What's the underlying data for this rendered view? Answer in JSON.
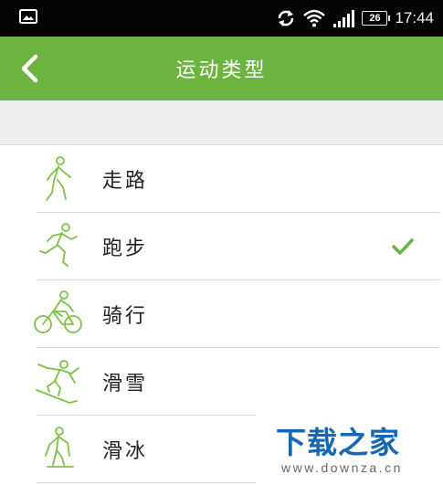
{
  "status_bar": {
    "time": "17:44",
    "battery_level": "26",
    "icons": [
      "gallery-icon",
      "sync-icon",
      "wifi-icon",
      "signal-icon",
      "battery-icon"
    ]
  },
  "app_bar": {
    "title": "运动类型",
    "back_icon": "back-arrow-icon",
    "background": "#6cb33f"
  },
  "sport_types": [
    {
      "label": "走路",
      "icon": "walking-icon",
      "selected": false
    },
    {
      "label": "跑步",
      "icon": "running-icon",
      "selected": true
    },
    {
      "label": "骑行",
      "icon": "cycling-icon",
      "selected": false
    },
    {
      "label": "滑雪",
      "icon": "skiing-icon",
      "selected": false
    },
    {
      "label": "滑冰",
      "icon": "skating-icon",
      "selected": false
    }
  ],
  "colors": {
    "accent": "#6cb33f",
    "icon_stroke": "#7cc247",
    "text": "#222222"
  },
  "watermark": {
    "logo": "下载之家",
    "url": "www.downza.cn"
  }
}
